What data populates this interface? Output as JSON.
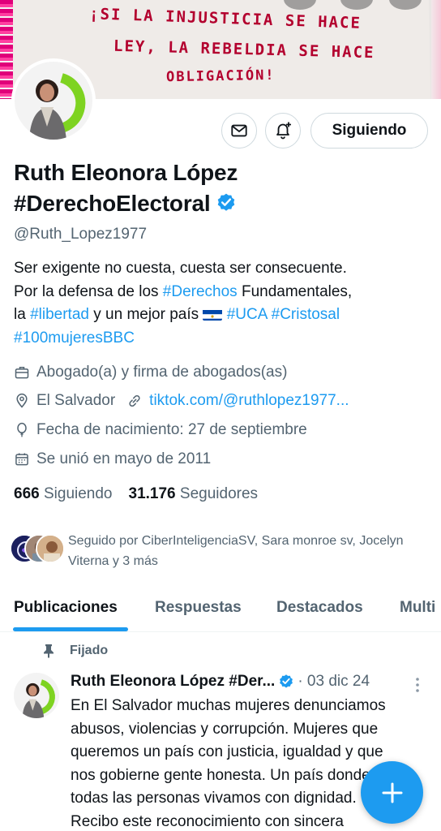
{
  "banner": {
    "line1": "¡SI LA INJUSTICIA SE HACE",
    "line2": "LEY, LA REBELDIA SE HACE",
    "line3": "OBLIGACIÓN!"
  },
  "actions": {
    "follow_label": "Siguiendo"
  },
  "profile": {
    "name_line1": "Ruth Eleonora López",
    "name_line2": "#DerechoElectoral",
    "handle": "@Ruth_Lopez1977",
    "bio": {
      "l1": "Ser exigente no cuesta, cuesta ser consecuente.",
      "l2a": "Por la defensa de los ",
      "l2_link": "#Derechos",
      "l2b": " Fundamentales,",
      "l3a": "la ",
      "l3_link": "#libertad",
      "l3b": " y un mejor país ",
      "l3_link2": "#UCA",
      "l3_link3": "#Cristosal",
      "l4_link": "#100mujeresBBC"
    },
    "category": "Abogado(a) y firma de abogados(as)",
    "location": "El Salvador",
    "website": "tiktok.com/@ruthlopez1977...",
    "birthday": "Fecha de nacimiento: 27 de septiembre",
    "joined": "Se unió en mayo de 2011",
    "following_count": "666",
    "following_label": "Siguiendo",
    "followers_count": "31.176",
    "followers_label": "Seguidores",
    "followed_by": "Seguido por CiberInteligenciaSV, Sara monroe sv, Jocelyn Viterna y 3 más"
  },
  "tabs": [
    {
      "label": "Publicaciones"
    },
    {
      "label": "Respuestas"
    },
    {
      "label": "Destacados"
    },
    {
      "label": "Multi"
    }
  ],
  "pinned_tweet": {
    "pinned_label": "Fijado",
    "author": "Ruth Eleonora López #Der...",
    "date": "· 03 dic 24",
    "text_lines": [
      "En El Salvador muchas mujeres denunciamos",
      "abusos, violencias y corrupción. Mujeres que",
      "queremos un país con justicia, igualdad y que",
      "nos gobierne gente honesta. Un país donde",
      "todas las personas vivamos con dignidad.",
      "Recibo este reconocimiento con sincera"
    ]
  },
  "colors": {
    "accent": "#1d9bf0",
    "text": "#0f1419",
    "secondary": "#536471",
    "banner_ink": "#b3002e"
  }
}
